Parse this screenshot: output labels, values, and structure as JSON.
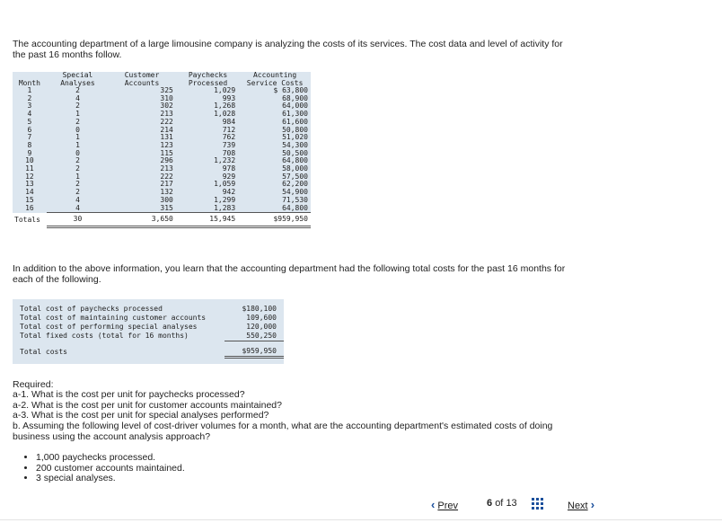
{
  "intro": "The accounting department of a large limousine company is analyzing the costs of its services. The cost data and level of activity for the past 16 months follow.",
  "table": {
    "headers": {
      "month": "Month",
      "special_1": "Special",
      "special_2": "Analyses",
      "customer_1": "Customer",
      "customer_2": "Accounts",
      "paychecks_1": "Paychecks",
      "paychecks_2": "Processed",
      "accounting_1": "Accounting",
      "accounting_2": "Service Costs"
    },
    "rows": [
      {
        "month": "1",
        "special": "2",
        "customer": "325",
        "paychecks": "1,029",
        "cost": "$ 63,800"
      },
      {
        "month": "2",
        "special": "4",
        "customer": "310",
        "paychecks": "993",
        "cost": "68,900"
      },
      {
        "month": "3",
        "special": "2",
        "customer": "302",
        "paychecks": "1,268",
        "cost": "64,000"
      },
      {
        "month": "4",
        "special": "1",
        "customer": "213",
        "paychecks": "1,028",
        "cost": "61,300"
      },
      {
        "month": "5",
        "special": "2",
        "customer": "222",
        "paychecks": "984",
        "cost": "61,600"
      },
      {
        "month": "6",
        "special": "0",
        "customer": "214",
        "paychecks": "712",
        "cost": "50,800"
      },
      {
        "month": "7",
        "special": "1",
        "customer": "131",
        "paychecks": "762",
        "cost": "51,020"
      },
      {
        "month": "8",
        "special": "1",
        "customer": "123",
        "paychecks": "739",
        "cost": "54,300"
      },
      {
        "month": "9",
        "special": "0",
        "customer": "115",
        "paychecks": "708",
        "cost": "50,500"
      },
      {
        "month": "10",
        "special": "2",
        "customer": "296",
        "paychecks": "1,232",
        "cost": "64,800"
      },
      {
        "month": "11",
        "special": "2",
        "customer": "213",
        "paychecks": "978",
        "cost": "58,000"
      },
      {
        "month": "12",
        "special": "1",
        "customer": "222",
        "paychecks": "929",
        "cost": "57,500"
      },
      {
        "month": "13",
        "special": "2",
        "customer": "217",
        "paychecks": "1,059",
        "cost": "62,200"
      },
      {
        "month": "14",
        "special": "2",
        "customer": "132",
        "paychecks": "942",
        "cost": "54,900"
      },
      {
        "month": "15",
        "special": "4",
        "customer": "300",
        "paychecks": "1,299",
        "cost": "71,530"
      },
      {
        "month": "16",
        "special": "4",
        "customer": "315",
        "paychecks": "1,283",
        "cost": "64,800"
      }
    ],
    "totals": {
      "label": "Totals",
      "special": "30",
      "customer": "3,650",
      "paychecks": "15,945",
      "cost": "$959,950"
    }
  },
  "addition": "In addition to the above information, you learn that the accounting department had the following total costs for the past 16 months for each of the following.",
  "cost_table": {
    "rows": [
      {
        "label": "Total cost of paychecks processed",
        "value": "$180,100"
      },
      {
        "label": "Total cost of maintaining customer accounts",
        "value": "109,600"
      },
      {
        "label": "Total cost of performing special analyses",
        "value": "120,000"
      },
      {
        "label": "Total fixed costs (total for 16 months)",
        "value": "550,250"
      }
    ],
    "total": {
      "label": "Total costs",
      "value": "$959,950"
    }
  },
  "required": {
    "heading": "Required:",
    "a1": "a-1. What is the cost per unit for paychecks processed?",
    "a2": "a-2. What is the cost per unit for customer accounts maintained?",
    "a3": "a-3. What is the cost per unit for special analyses performed?",
    "b": "b. Assuming the following level of cost-driver volumes for a month, what are the accounting department's estimated costs of doing business using the account analysis approach?",
    "bullets": [
      "1,000 paychecks processed.",
      "200 customer accounts maintained.",
      "3 special analyses."
    ]
  },
  "pager": {
    "prev": "Prev",
    "current": "6",
    "of": "of",
    "total": "13",
    "next": "Next",
    "icon": "grid-icon"
  },
  "colors": {
    "table_bg": "#dce6ef",
    "accent": "#1b4f9c"
  }
}
